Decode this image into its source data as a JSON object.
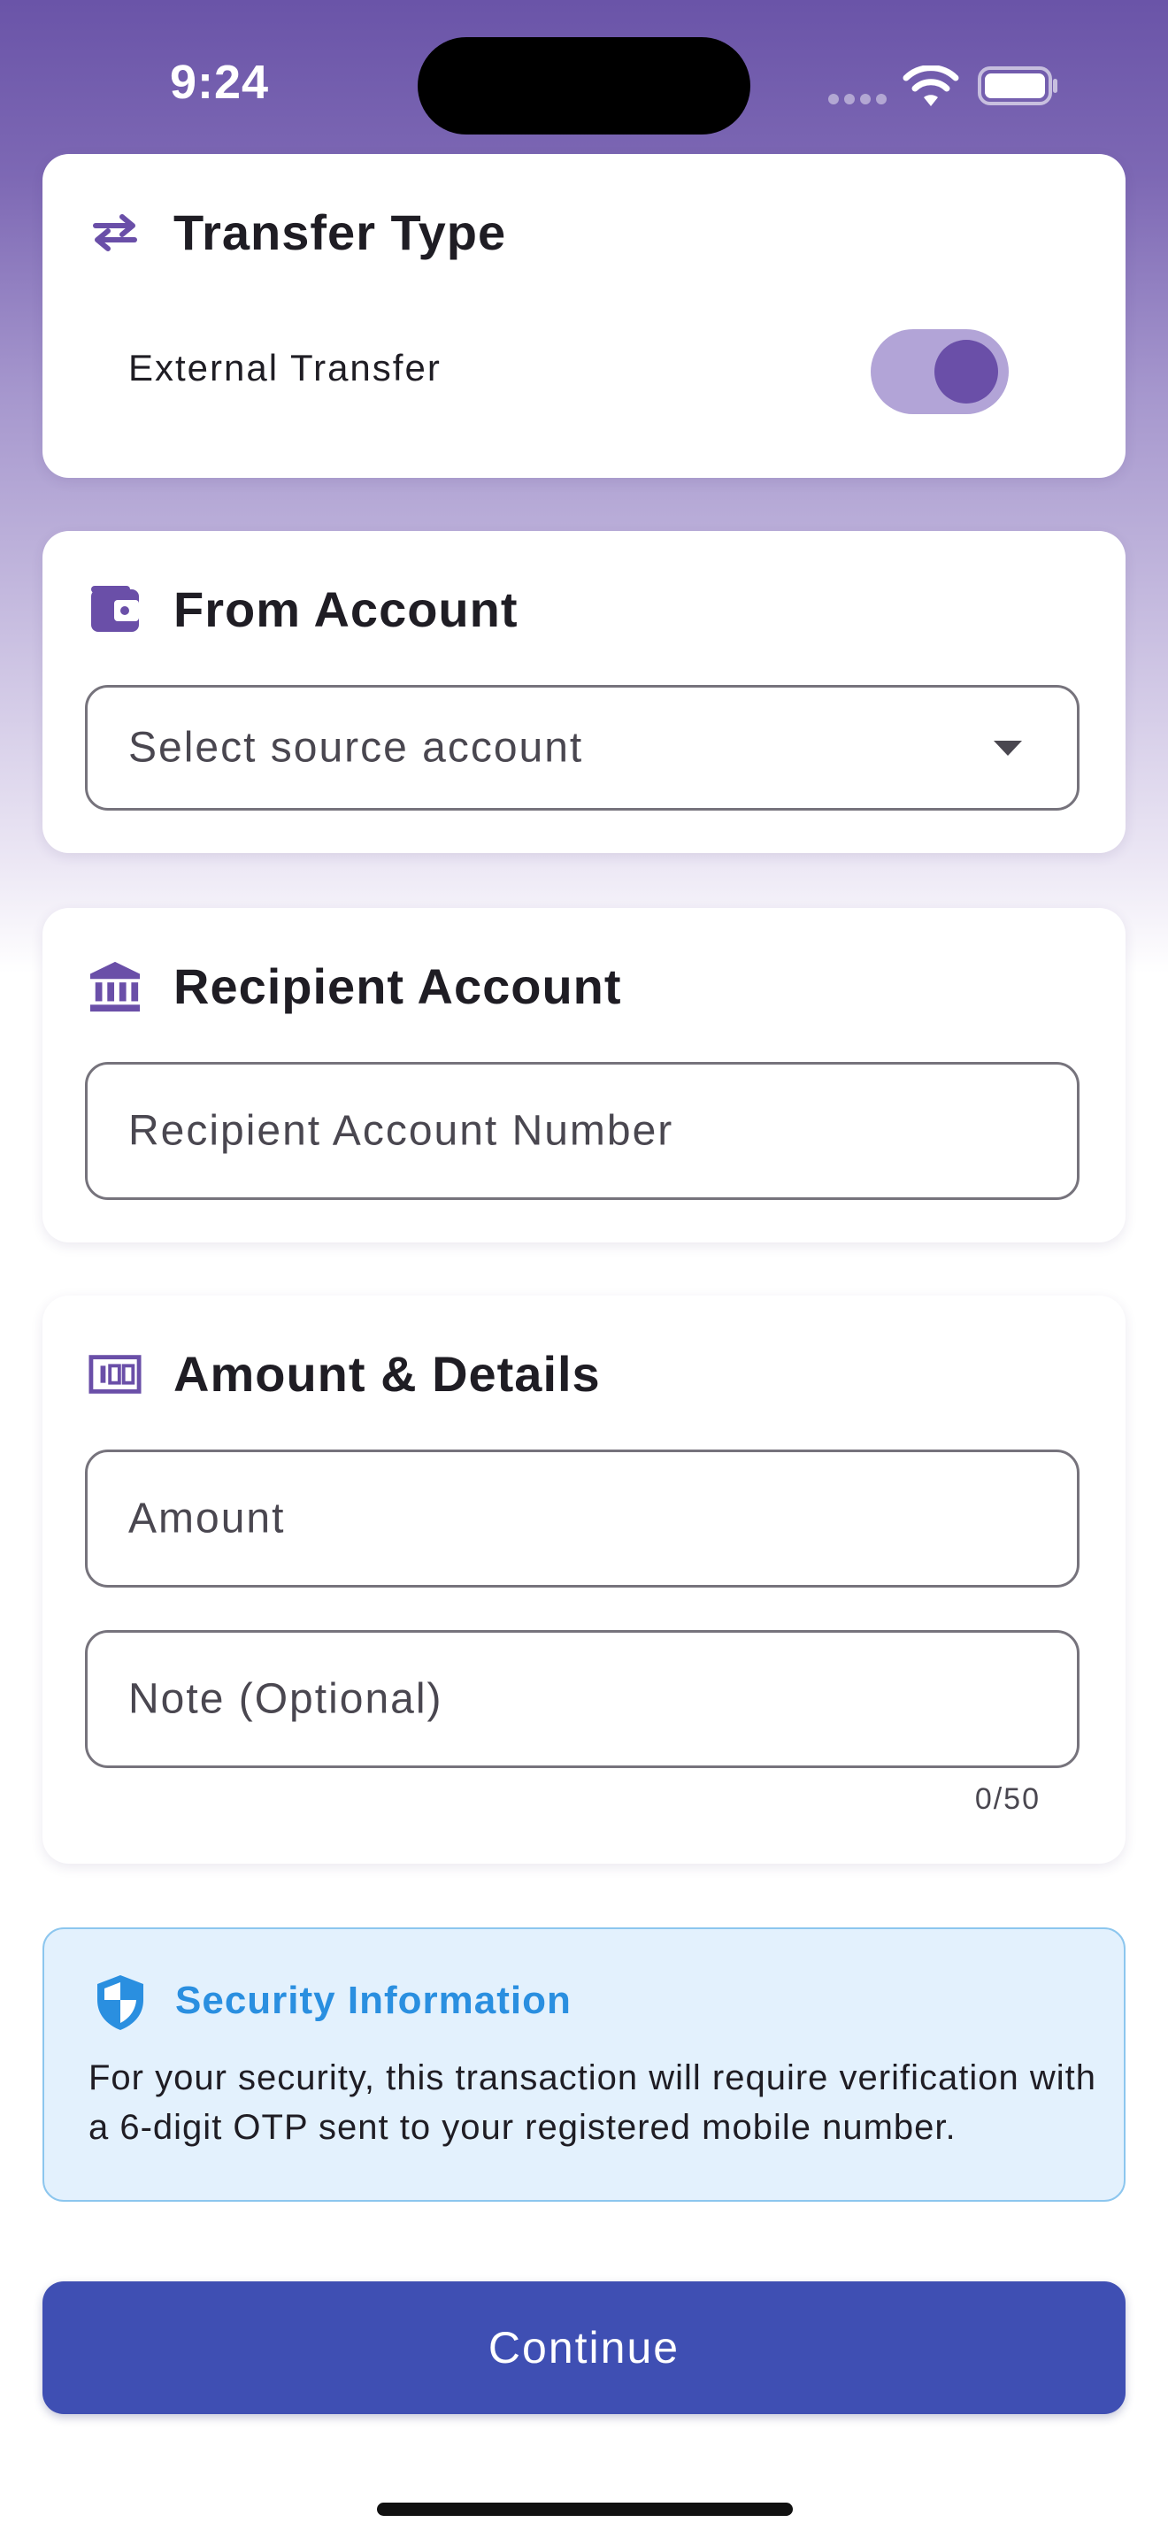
{
  "status_bar": {
    "time": "9:24"
  },
  "transfer_type": {
    "title": "Transfer Type",
    "icon": "swap-arrows-icon",
    "toggle_label": "External Transfer",
    "toggle_on": true
  },
  "from_account": {
    "title": "From Account",
    "icon": "wallet-icon",
    "select_placeholder": "Select source account"
  },
  "recipient_account": {
    "title": "Recipient Account",
    "icon": "bank-icon",
    "input_placeholder": "Recipient Account Number"
  },
  "amount_details": {
    "title": "Amount & Details",
    "icon": "banknote-icon",
    "amount_placeholder": "Amount",
    "note_placeholder": "Note (Optional)",
    "note_counter": "0/50"
  },
  "security": {
    "title": "Security Information",
    "icon": "shield-icon",
    "body": "For your security, this transaction will require verification with a 6-digit OTP sent to your registered mobile number."
  },
  "continue_label": "Continue",
  "colors": {
    "accent": "#6a4fa8",
    "primary_button": "#3f4fb3",
    "info_blue": "#2a8fe0"
  }
}
